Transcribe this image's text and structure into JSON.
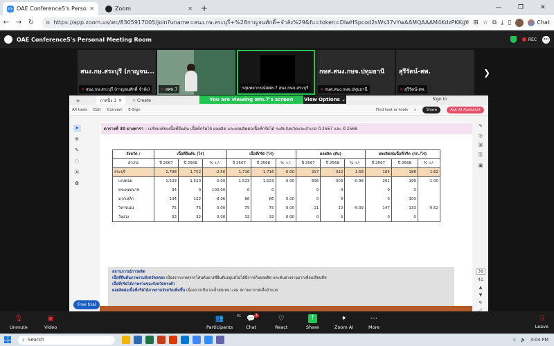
{
  "browser": {
    "tabs": [
      {
        "title": "OAE Conference5's Personal M",
        "active": true
      },
      {
        "title": "Zoom",
        "active": false
      }
    ],
    "url": "https://app.zoom.us/wc/8305917005/join?uname=สนง.กษ.สระบุรี+%28กาญจนศักดิ์+จำลัง%29&fu=token=DlwHSpcod2sWs37vYwAAMQAAAM4KdzPKKgW1FGutLpH...",
    "chat_label": "Chat",
    "window_controls": [
      "—",
      "❐",
      "✕"
    ]
  },
  "zoom": {
    "meeting_title": "OAE Conference5's Personal Meeting Room",
    "rec_label": "REC",
    "participants": [
      {
        "big_name": "สนง.กษ.สระบุรี (กาญจน...",
        "label": "สนง.กษ.สระบุรี (กาญจนศักดิ์ จำลัง)",
        "type": "name"
      },
      {
        "big_name": "",
        "label": "สศท.7",
        "type": "video"
      },
      {
        "big_name": "",
        "label": "กลุ่มพยากรณ์สศท.7 สนง.กษจ.สระบุรี",
        "type": "dark"
      },
      {
        "big_name": "กษส.สนง.กษจ.ปทุมธานี",
        "label": "กษส.สนง.กษจ.ปทุมธานี",
        "type": "name"
      },
      {
        "big_name": "สุรีรัตน์-สพ.",
        "label": "สุรีรัตน์-สพ.",
        "type": "name"
      }
    ],
    "viewing_banner": "You are viewing สศท.7's screen",
    "view_options": "View Options",
    "toolbar": {
      "unmute": "Unmute",
      "video": "Video",
      "participants": "Participants",
      "participants_count": "41",
      "chat": "Chat",
      "chat_badge": "1",
      "react": "React",
      "share": "Share",
      "zoom_ai": "Zoom AI",
      "more": "More",
      "leave": "Leave"
    }
  },
  "acrobat": {
    "tab_title": "ภาพนิ่ง 1",
    "create_label": "Create",
    "sign_in": "Sign in",
    "menu": [
      "All tools",
      "Edit",
      "Convert",
      "E-Sign"
    ],
    "find_text": "Find text or tools",
    "share_label": "Share",
    "ai_label": "Ask AI Assistant",
    "free_trial": "Free trial",
    "page_numbers": [
      "38",
      "41"
    ],
    "page": {
      "title_bold": "ตารางที่ 30 ยางพารา",
      "title_rest": ": เปรียบเทียบเนื้อที่ยืนต้น เนื้อที่กรีดได้ ผลผลิต และผลผลิตต่อเนื้อที่กรีดได้ ระดับจังหวัดและอำเภอ ปี 2567 และ ปี 2568",
      "header_groups": [
        "จังหวัด /",
        "เนื้อที่ยืนต้น (ไร่)",
        "เนื้อที่กรีด (ไร่)",
        "ผลผลิต (ตัน)",
        "ผลผลิตต่อเนื้อที่กรีด (กก./ไร่)"
      ],
      "header_sub": [
        "อำเภอ",
        "ปี 2567",
        "ปี 2568",
        "% +/-",
        "ปี 2567",
        "ปี 2568",
        "% +/-",
        "ปี 2567",
        "ปี 2568",
        "% +/-",
        "ปี 2567",
        "ปี 2568",
        "% +/-"
      ],
      "rows": [
        {
          "name": "สระบุรี",
          "v": [
            "1,798",
            "1,752",
            "-2.56",
            "1,716",
            "1,716",
            "0.00",
            "317",
            "322",
            "1.58",
            "185",
            "188",
            "1.62"
          ],
          "province": true
        },
        {
          "name": "แก่งคอย",
          "v": [
            "1,523",
            "1,523",
            "0.00",
            "1,523",
            "1,523",
            "0.00",
            "306",
            "303",
            "-0.98",
            "201",
            "199",
            "-1.00"
          ]
        },
        {
          "name": "พระพุทธบาท",
          "v": [
            "34",
            "0",
            "100.00",
            "0",
            "0",
            "",
            "0",
            "0",
            "",
            "0",
            "0",
            ""
          ]
        },
        {
          "name": "มวกเหล็ก",
          "v": [
            "134",
            "122",
            "-8.96",
            "86",
            "86",
            "0.00",
            "0",
            "9",
            "",
            "0",
            "103",
            ""
          ]
        },
        {
          "name": "วิหารแดง",
          "v": [
            "75",
            "75",
            "0.00",
            "75",
            "75",
            "0.00",
            "11",
            "10",
            "-9.09",
            "147",
            "133",
            "-9.52"
          ]
        },
        {
          "name": "วังม่วง",
          "v": [
            "32",
            "32",
            "0.00",
            "32",
            "32",
            "0.00",
            "0",
            "0",
            "",
            "0",
            "0",
            ""
          ]
        }
      ],
      "situation_head": "สถานการณ์การผลิต",
      "situation_lines": [
        {
          "hl": "เนื้อที่ยืนต้นภาพรวมจังหวัดลดลง",
          "rest": " เนื่องจากเกษตรกรโค่นต้นยางที่ยืนต้นอยู่แต่ไม่ได้มีการเก็บผลผลิต และต้นยางอายุมากเพื่อเปลี่ยนพืช"
        },
        {
          "hl": "เนื้อที่กรีดได้ภาพรวมของจังหวัดทรงตัว",
          "rest": ""
        },
        {
          "hl": "ผลผลิตต่อเนื้อที่กรีดได้ภาพรวมจังหวัดเพิ่มขึ้น",
          "rest": " เนื่องจากปริมาณน้ำฝนเหมาะสม สภาพอากาศเอื้ออำนวย"
        }
      ]
    }
  },
  "taskbar": {
    "search_placeholder": "Search",
    "time": "3:04 PM"
  },
  "colors": {
    "zoom_green": "#23c552",
    "province_row": "#f6d9b8",
    "title_bg": "#f6e1f2",
    "rec_red": "#e02828"
  }
}
